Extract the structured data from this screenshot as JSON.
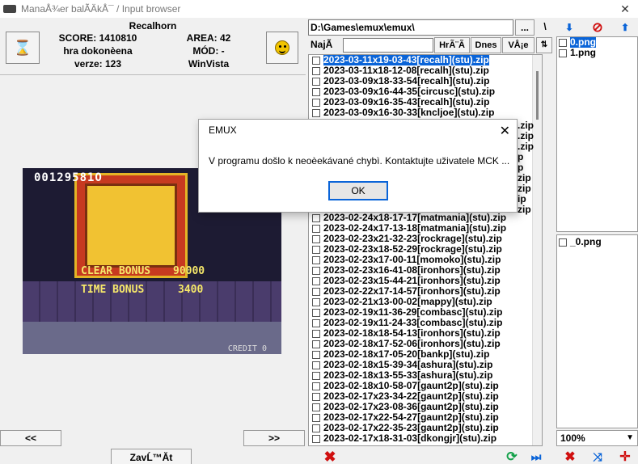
{
  "window": {
    "title": "ManaÅ¾er balÃÄkÅ¯ / Input browser",
    "close": "✕"
  },
  "info": {
    "game_name": "Recalhorn",
    "score": "SCORE: 1410810",
    "status": "hra dokonèena",
    "verze": "verze: 123",
    "area": "AREA: 42",
    "mod": "MÓD: -",
    "platform": "WinVista"
  },
  "screenshot": {
    "score_text": "00129581O",
    "clear_bonus": "CLEAR BONUS",
    "clear_val": "90000",
    "time_bonus": "TIME BONUS",
    "time_val": "3400",
    "credit": "CREDIT 0"
  },
  "nav": {
    "prev": "<<",
    "next": ">>"
  },
  "bottom": {
    "close_label": "ZavĹ™Ă­t"
  },
  "path": {
    "value": "D:\\Games\\emux\\emux\\",
    "browse": "...",
    "root": "\\"
  },
  "filter": {
    "label": "NajÃ­",
    "tab_hraci": "HrÃ¨Ã",
    "tab_dnes": "Dnes",
    "tab_vse": "VÅ¡e"
  },
  "files": [
    {
      "name": "2023-03-11x19-03-43[recalh](stu).zip",
      "selected": true
    },
    {
      "name": "2023-03-11x18-12-08[recalh](stu).zip"
    },
    {
      "name": "2023-03-09x18-33-54[recalh](stu).zip"
    },
    {
      "name": "2023-03-09x16-44-35[circusc](stu).zip"
    },
    {
      "name": "2023-03-09x16-35-43[recalh](stu).zip"
    },
    {
      "name": "2023-03-09x16-30-33[kncljoe](stu).zip"
    },
    {
      "name": ""
    },
    {
      "name": ""
    },
    {
      "name": ""
    },
    {
      "name": ""
    },
    {
      "name": ""
    },
    {
      "name": ""
    },
    {
      "name": ""
    },
    {
      "name": ""
    },
    {
      "name": ""
    },
    {
      "name": "2023-02-24x18-17-17[matmania](stu).zip"
    },
    {
      "name": "2023-02-24x17-13-18[matmania](stu).zip"
    },
    {
      "name": "2023-02-23x21-32-23[rockrage](stu).zip"
    },
    {
      "name": "2023-02-23x18-52-29[rockrage](stu).zip"
    },
    {
      "name": "2023-02-23x17-00-11[momoko](stu).zip"
    },
    {
      "name": "2023-02-23x16-41-08[ironhors](stu).zip"
    },
    {
      "name": "2023-02-23x15-44-21[ironhors](stu).zip"
    },
    {
      "name": "2023-02-22x17-14-57[ironhors](stu).zip"
    },
    {
      "name": "2023-02-21x13-00-02[mappy](stu).zip"
    },
    {
      "name": "2023-02-19x11-36-29[combasc](stu).zip"
    },
    {
      "name": "2023-02-19x11-24-33[combasc](stu).zip"
    },
    {
      "name": "2023-02-18x18-54-13[ironhors](stu).zip"
    },
    {
      "name": "2023-02-18x17-52-06[ironhors](stu).zip"
    },
    {
      "name": "2023-02-18x17-05-20[bankp](stu).zip"
    },
    {
      "name": "2023-02-18x15-39-34[ashura](stu).zip"
    },
    {
      "name": "2023-02-18x13-55-33[ashura](stu).zip"
    },
    {
      "name": "2023-02-18x10-58-07[gaunt2p](stu).zip"
    },
    {
      "name": "2023-02-17x23-34-22[gaunt2p](stu).zip"
    },
    {
      "name": "2023-02-17x23-08-36[gaunt2p](stu).zip"
    },
    {
      "name": "2023-02-17x22-54-27[gaunt2p](stu).zip"
    },
    {
      "name": "2023-02-17x22-35-23[gaunt2p](stu).zip"
    },
    {
      "name": "2023-02-17x18-31-03[dkongjr](stu).zip"
    }
  ],
  "files_partial_tail": [
    ".zip",
    ".zip",
    ".zip",
    "p",
    "p",
    "zip",
    "zip",
    "ip",
    "zip"
  ],
  "png_files": [
    {
      "name": "0.png",
      "selected": true
    },
    {
      "name": "1.png"
    }
  ],
  "png_files_2": [
    {
      "name": "_0.png"
    }
  ],
  "zoom": {
    "value": "100%"
  },
  "dialog": {
    "title": "EMUX",
    "close": "✕",
    "message": "V programu došlo k neoèekávané chybì. Kontaktujte uživatele MCK ...",
    "ok": "OK"
  },
  "colors": {
    "accent": "#0a64d8",
    "danger": "#d01010",
    "ok_green": "#14a14a"
  }
}
